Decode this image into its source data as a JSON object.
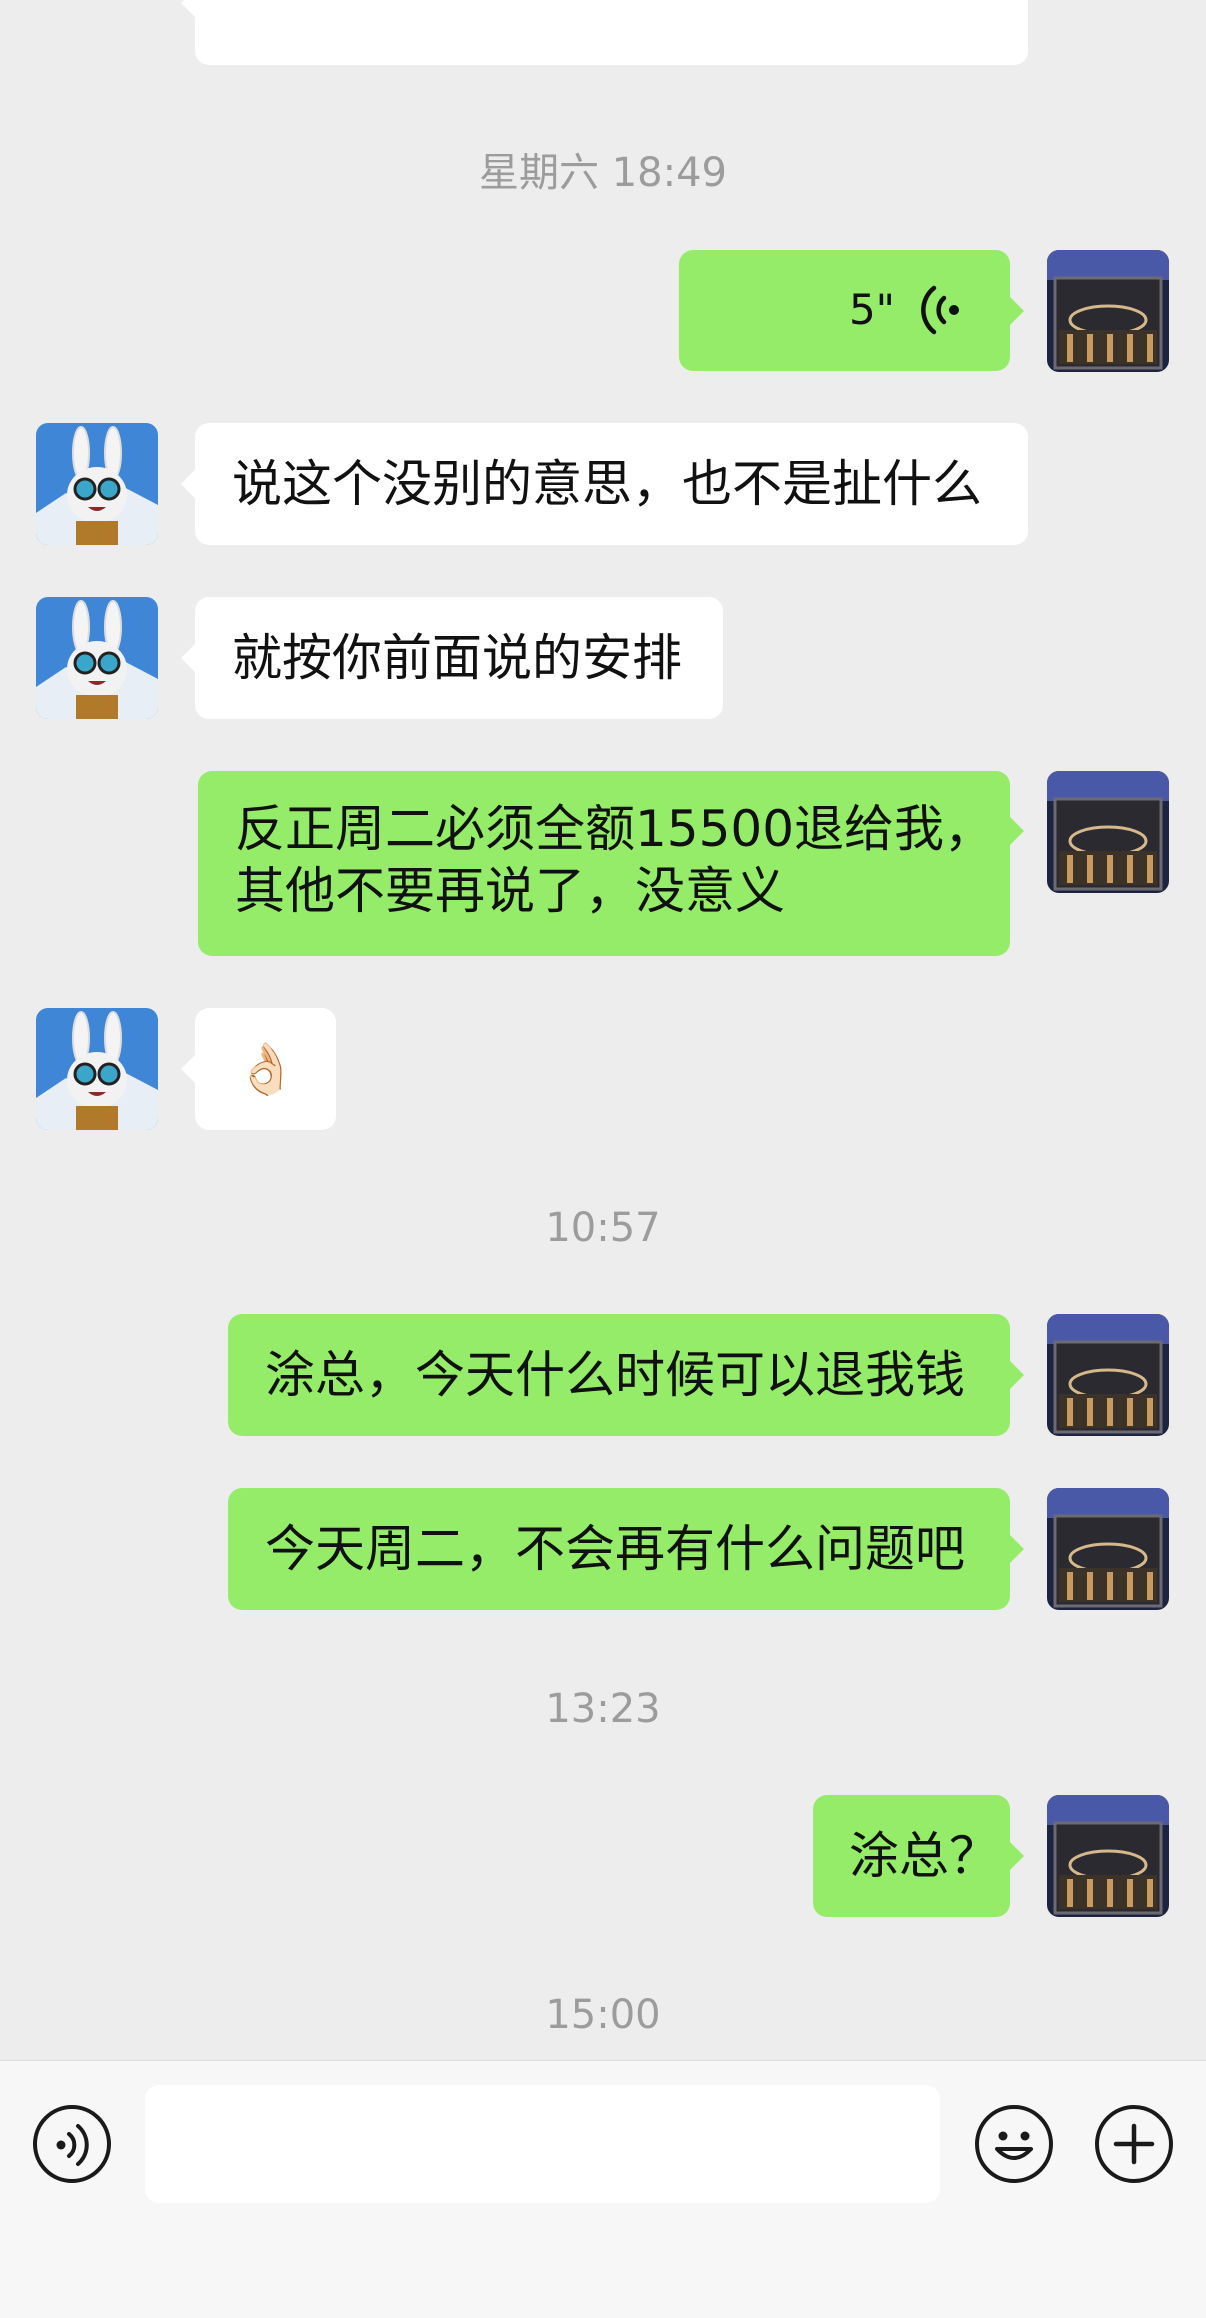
{
  "messages": {
    "ts1": "星期六 18:49",
    "voice_duration": "5\"",
    "in1": "说这个没别的意思，也不是扯什么",
    "in2": "就按你前面说的安排",
    "out1_line1": "反正周二必须全额15500退给我，",
    "out1_line2": "其他不要再说了，没意义",
    "in3_emoji": "👌🏻",
    "ts2": "10:57",
    "out2": "涂总，今天什么时候可以退我钱",
    "out3": "今天周二，不会再有什么问题吧",
    "ts3": "13:23",
    "out4": "涂总？",
    "ts4": "15:00"
  },
  "icons": {
    "voice_toggle": "voice-mode-icon",
    "emoji": "emoji-face-icon",
    "more": "plus-icon",
    "voice_playback": "voice-wave-icon"
  },
  "colors": {
    "background": "#ededed",
    "outgoing_bubble": "#95ec69",
    "incoming_bubble": "#ffffff",
    "timestamp": "#9c9c9c"
  }
}
